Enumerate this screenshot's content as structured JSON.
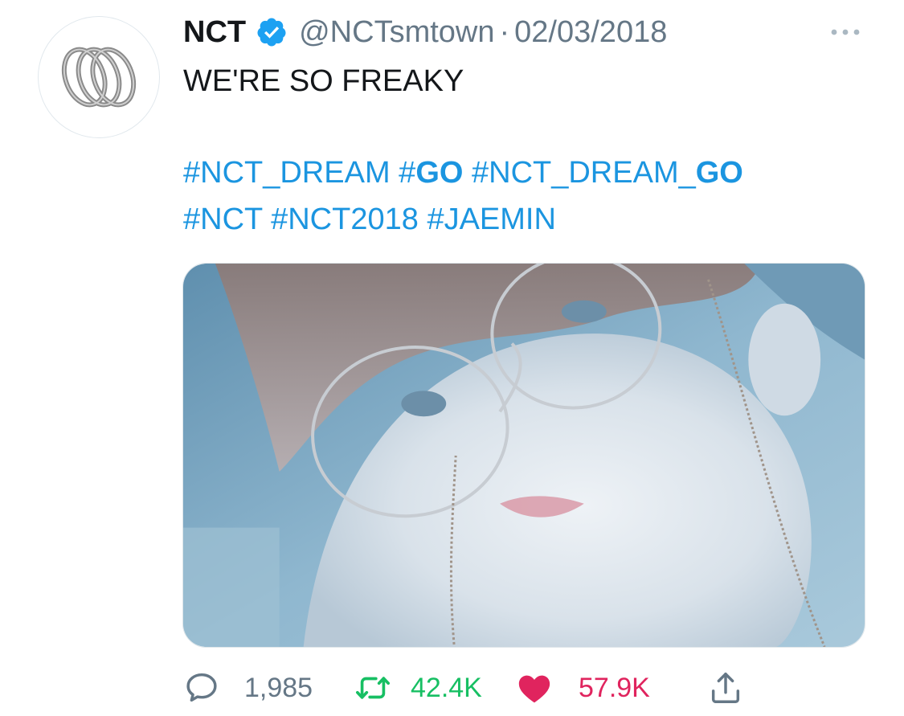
{
  "tweet": {
    "display_name": "NCT",
    "handle": "@NCTsmtown",
    "separator": "·",
    "date": "02/03/2018",
    "text_line1": "WE'RE SO FREAKY",
    "hashtag_lines": [
      [
        {
          "prefix": "#NCT_DREAM",
          "bold": ""
        },
        {
          "prefix": "#",
          "bold": "GO"
        },
        {
          "prefix": "#NCT_DREAM_",
          "bold": "GO"
        }
      ],
      [
        {
          "prefix": "#NCT",
          "bold": ""
        },
        {
          "prefix": "#NCT2018",
          "bold": ""
        },
        {
          "prefix": "#JAEMIN",
          "bold": ""
        }
      ]
    ]
  },
  "actions": {
    "reply_count": "1,985",
    "retweet_count": "42.4K",
    "like_count": "57.9K"
  },
  "icons": {
    "verified": "verified-badge-icon",
    "more": "more-dots-icon",
    "reply": "reply-bubble-icon",
    "retweet": "retweet-arrows-icon",
    "like": "heart-icon",
    "share": "share-arrow-icon"
  },
  "colors": {
    "link": "#1b95e0",
    "muted": "#657786",
    "retweet": "#17bf63",
    "like": "#e0245e",
    "verified": "#1da1f2"
  }
}
